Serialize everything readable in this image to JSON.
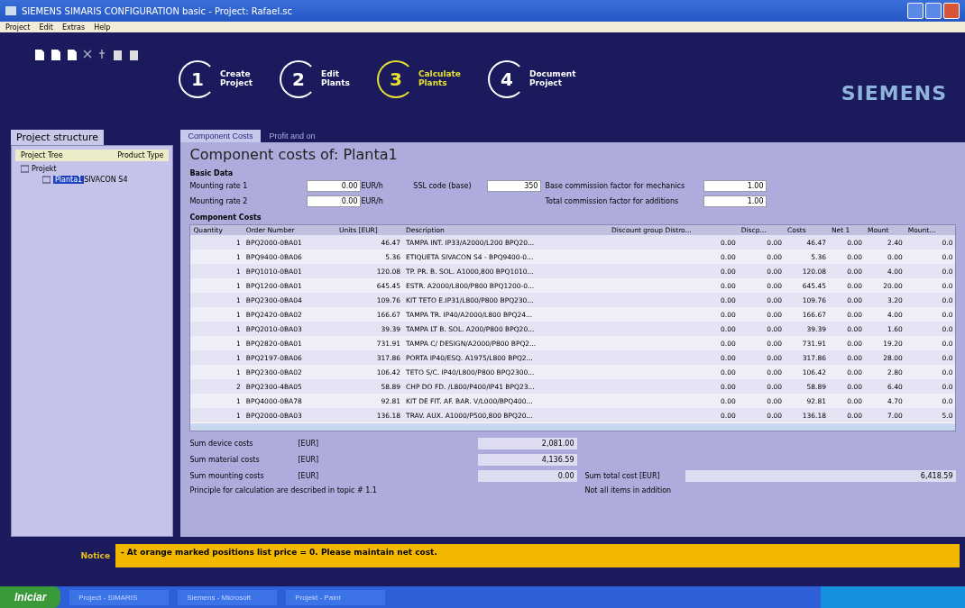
{
  "window": {
    "title": "SIEMENS  SIMARIS CONFIGURATION basic  -  Project: Rafael.sc"
  },
  "menu": [
    "Project",
    "Edit",
    "Extras",
    "Help"
  ],
  "steps": [
    {
      "number": "1",
      "label": "Create\nProject",
      "selected": false
    },
    {
      "number": "2",
      "label": "Edit\nPlants",
      "selected": false
    },
    {
      "number": "3",
      "label": "Calculate\nPlants",
      "selected": true
    },
    {
      "number": "4",
      "label": "Document\nProject",
      "selected": false
    }
  ],
  "brand": "SIEMENS",
  "project_structure": {
    "title": "Project structure",
    "columns": [
      "Project Tree",
      "Product Type"
    ],
    "tree": [
      {
        "label": "Projekt",
        "expanded": true,
        "selected": false,
        "children": [
          {
            "label": "Planta1",
            "product": "SIVACON S4",
            "selected": true
          }
        ]
      }
    ]
  },
  "tabs": [
    {
      "label": "Component Costs",
      "selected": true
    },
    {
      "label": "Profit and on",
      "selected": false
    }
  ],
  "heading": "Component costs of: Planta1",
  "basic_data": {
    "title": "Basic Data",
    "fields": [
      {
        "label": "Mounting rate 1",
        "value": "0.00",
        "unit": "EUR/h"
      },
      {
        "label": "Mounting rate 2",
        "value": "0.00",
        "unit": "EUR/h"
      }
    ],
    "mid_label": "SSL code (base)",
    "mid_value": "350",
    "right_fields": [
      {
        "label": "Base commission factor for mechanics",
        "value": "1.00"
      },
      {
        "label": "Total commission factor for additions",
        "value": "1.00"
      }
    ]
  },
  "component_costs": {
    "title": "Component Costs",
    "columns": [
      "Quantity",
      "Order Number",
      "Units [EUR]",
      "Description",
      "Discount group Distro...",
      "Discp...",
      "Costs",
      "Net 1",
      "Mount",
      "Mount..."
    ],
    "rows": [
      [
        "1",
        "BPQ2000-0BA01",
        "46.47",
        "TAMPA INT. IP33/A2000/L200 BPQ20...",
        "0.00",
        "0.00",
        "46.47",
        "0.00",
        "2.40",
        "0.0"
      ],
      [
        "1",
        "BPQ9400-0BA06",
        "5.36",
        "ETIQUETA  SIVACON S4 - BPQ9400-0...",
        "0.00",
        "0.00",
        "5.36",
        "0.00",
        "0.00",
        "0.0"
      ],
      [
        "1",
        "BPQ1010-0BA01",
        "120.08",
        "TP. PR. B. SOL. A1000,800 BPQ1010...",
        "0.00",
        "0.00",
        "120.08",
        "0.00",
        "4.00",
        "0.0"
      ],
      [
        "1",
        "BPQ1200-0BA01",
        "645.45",
        "ESTR.  A2000/L800/P800 BPQ1200-0...",
        "0.00",
        "0.00",
        "645.45",
        "0.00",
        "20.00",
        "0.0"
      ],
      [
        "1",
        "BPQ2300-0BA04",
        "109.76",
        "KIT TETO E.IP31/L800/P800 BPQ230...",
        "0.00",
        "0.00",
        "109.76",
        "0.00",
        "3.20",
        "0.0"
      ],
      [
        "1",
        "BPQ2420-0BA02",
        "166.67",
        "TAMPA TR. IP40/A2000/L800 BPQ24...",
        "0.00",
        "0.00",
        "166.67",
        "0.00",
        "4.00",
        "0.0"
      ],
      [
        "1",
        "BPQ2010-0BA03",
        "39.39",
        "TAMPA LT B. SOL. A200/P800 BPQ20...",
        "0.00",
        "0.00",
        "39.39",
        "0.00",
        "1.60",
        "0.0"
      ],
      [
        "1",
        "BPQ2820-0BA01",
        "731.91",
        "TAMPA C/ DESIGN/A2000/P800 BPQ2...",
        "0.00",
        "0.00",
        "731.91",
        "0.00",
        "19.20",
        "0.0"
      ],
      [
        "1",
        "BPQ2197-0BA06",
        "317.86",
        "PORTA IP40/ESQ. A1975/L800  BPQ2...",
        "0.00",
        "0.00",
        "317.86",
        "0.00",
        "28.00",
        "0.0"
      ],
      [
        "1",
        "BPQ2300-0BA02",
        "106.42",
        "TETO S/C. IP40/L800/P800  BPQ2300...",
        "0.00",
        "0.00",
        "106.42",
        "0.00",
        "2.80",
        "0.0"
      ],
      [
        "2",
        "BPQ2300-4BA05",
        "58.89",
        "CHP DO FD. /L800/P400/IP41 BPQ23...",
        "0.00",
        "0.00",
        "58.89",
        "0.00",
        "6.40",
        "0.0"
      ],
      [
        "1",
        "BPQ4000-0BA78",
        "92.81",
        "KIT DE FIT. AF. BAR. V/L000/BPQ400...",
        "0.00",
        "0.00",
        "92.81",
        "0.00",
        "4.70",
        "0.0"
      ],
      [
        "1",
        "BPQ2000-0BA03",
        "136.18",
        "TRAV. AUX. A1000/P500,800 BPQ20...",
        "0.00",
        "0.00",
        "136.18",
        "0.00",
        "7.00",
        "5.0"
      ]
    ]
  },
  "sums": [
    {
      "label": "Sum device costs",
      "unit": "[EUR]",
      "value": "2,081.00"
    },
    {
      "label": "Sum material costs",
      "unit": "[EUR]",
      "value": "4,136.59"
    },
    {
      "label": "Sum mounting costs",
      "unit": "[EUR]",
      "value": "0.00"
    }
  ],
  "total": {
    "label": "Sum total cost [EUR]",
    "value": "6,418.59"
  },
  "footnote": "Principle for calculation are described in topic # 1.1",
  "total_note": "Not all items in addition",
  "notice": {
    "label": "Notice",
    "text": "- At orange marked positions list price = 0. Please maintain net cost."
  },
  "taskbar": {
    "start": "Iniciar",
    "items": [
      "Project - SIMARIS",
      "Siemens - Microsoft",
      "Projekt - Paint"
    ]
  }
}
